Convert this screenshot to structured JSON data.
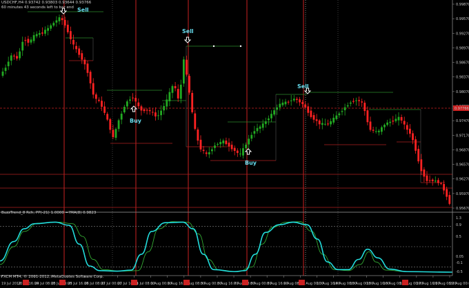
{
  "window": {
    "symbol_line": "USDCHF,H4 0.93742 0.93803 0.93644 0.93766",
    "timer_line": "60 minutes 43 seconds left to bar end",
    "indicator_line": "BuzzTrend_8 Rch, PP(-21) 1.0000 =?MA(8) 0.9823",
    "copyright": "FXCM MT4, © 2001-2012, MetaQuotes Software Corp."
  },
  "colors": {
    "background": "#000000",
    "bull": "#22aa22",
    "bear": "#ff2222",
    "grid_red": "#cc2222",
    "grid_dot": "#5a5a5a",
    "level_green": "#2d8a2d",
    "level_red": "#b02020",
    "osc_fast": "#22dddd",
    "osc_slow": "#33aa33",
    "signal_text": "#66ddee",
    "current_price": "#cc2222"
  },
  "signals": [
    {
      "type": "Sell",
      "label": "Sell",
      "arrow": "down-arrow-icon"
    },
    {
      "type": "Buy",
      "label": "Buy",
      "arrow": "up-arrow-icon"
    },
    {
      "type": "Sell",
      "label": "Sell",
      "arrow": "down-arrow-icon"
    },
    {
      "type": "Buy",
      "label": "Buy",
      "arrow": "up-arrow-icon"
    },
    {
      "type": "Sell",
      "label": "Sell",
      "arrow": "down-arrow-icon"
    }
  ],
  "price_axis": {
    "labels": [
      "0.99870",
      "0.99570",
      "0.99270",
      "0.98970",
      "0.98670",
      "0.98370",
      "0.98070",
      "0.97770",
      "0.97470",
      "0.97170",
      "0.96870",
      "0.96570",
      "0.96270",
      "0.95970",
      "0.95670"
    ],
    "current_price": "0.97766"
  },
  "osc_axis": {
    "labels": [
      "1.3",
      "0.9",
      "0.5",
      "0.05",
      "-0.1",
      "-0.5"
    ]
  },
  "date_axis": {
    "labels": [
      "19 Jul 2012",
      "20 Jul 16:00",
      "24 Jul 08:00",
      "25 Jul 00:00",
      "25 Jul 16:00",
      "26 Jul 08:00",
      "27 Jul 00:00",
      "27 Jul 16:00",
      "31 Jul 08:00",
      "1 Aug 00:00",
      "1 Aug 16:00",
      "2 Aug 08:00",
      "3 Aug 00:00",
      "3 Aug 16:00",
      "7 Aug 08:00",
      "8 Aug 00:00",
      "8 Aug 16:00",
      "9 Aug 08:00",
      "10 Aug 00:00",
      "10 Aug 16:00",
      "14 Aug 08:00",
      "15 Aug 00:00",
      "15 Aug 16:00",
      "16 Aug 08:00",
      "17 Aug 00:00",
      "17 Aug 16:00",
      "21 Aug 08:00",
      "22 Aug 00:00"
    ]
  }
}
